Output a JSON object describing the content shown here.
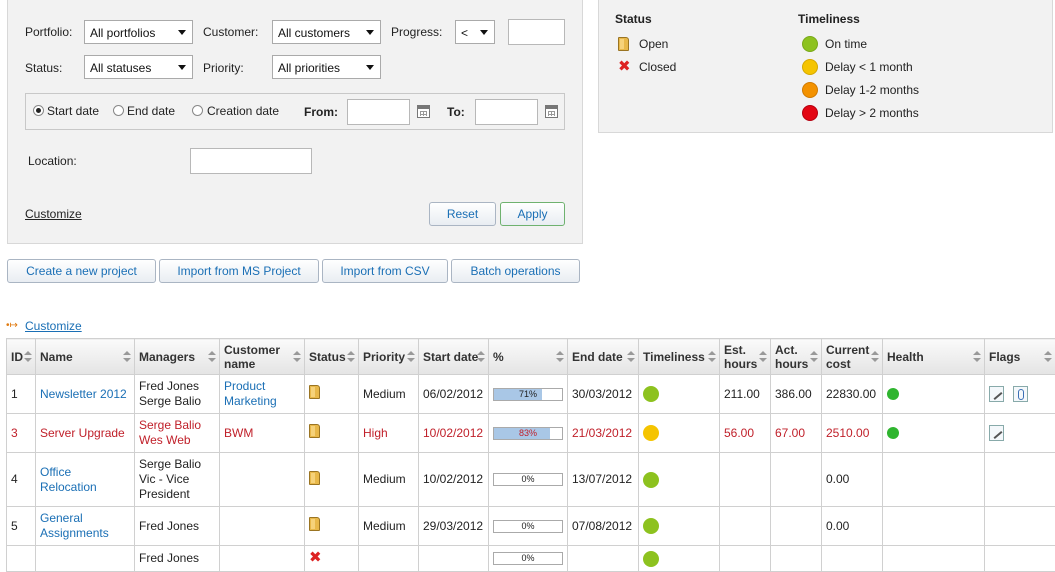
{
  "filters": {
    "portfolio_label": "Portfolio:",
    "portfolio_value": "All portfolios",
    "customer_label": "Customer:",
    "customer_value": "All customers",
    "progress_label": "Progress:",
    "progress_op": "<",
    "progress_value": "",
    "status_label": "Status:",
    "status_value": "All statuses",
    "priority_label": "Priority:",
    "priority_value": "All priorities",
    "date_options": [
      "Start date",
      "End date",
      "Creation date"
    ],
    "date_selected": "Start date",
    "from_label": "From:",
    "to_label": "To:",
    "location_label": "Location:",
    "customize_link": "Customize",
    "reset_button": "Reset",
    "apply_button": "Apply"
  },
  "legend": {
    "status_heading": "Status",
    "status_items": [
      {
        "label": "Open",
        "icon": "folder-icon"
      },
      {
        "label": "Closed",
        "icon": "closed-x-icon"
      }
    ],
    "timeliness_heading": "Timeliness",
    "timeliness_items": [
      {
        "label": "On time",
        "color": "#8dc21f"
      },
      {
        "label": "Delay < 1 month",
        "color": "#f5c400"
      },
      {
        "label": "Delay 1-2 months",
        "color": "#f39200"
      },
      {
        "label": "Delay > 2 months",
        "color": "#e30613"
      }
    ]
  },
  "actions": {
    "create": "Create a new project",
    "import_ms": "Import from MS Project",
    "import_csv": "Import from CSV",
    "batch": "Batch operations"
  },
  "table_customize": "Customize",
  "columns": {
    "id": "ID",
    "name": "Name",
    "managers": "Managers",
    "customer": "Customer name",
    "status": "Status",
    "priority": "Priority",
    "start": "Start date",
    "pct": "%",
    "end": "End date",
    "timeliness": "Timeliness",
    "est": "Est. hours",
    "act": "Act. hours",
    "cost": "Current cost",
    "health": "Health",
    "flags": "Flags"
  },
  "rows": [
    {
      "id": "1",
      "name": "Newsletter 2012",
      "managers": [
        "Fred Jones",
        "Serge Balio"
      ],
      "customer": "Product Marketing",
      "status": "open",
      "priority": "Medium",
      "start": "06/02/2012",
      "pct": 71,
      "pct_label": "71%",
      "end": "30/03/2012",
      "timeliness": "#8dc21f",
      "est": "211.00",
      "act": "386.00",
      "cost": "22830.00",
      "health": "#2fb52f",
      "flags": [
        "note-flag-icon",
        "attachment-flag-icon"
      ],
      "overdue": false
    },
    {
      "id": "3",
      "name": "Server Upgrade",
      "managers": [
        "Serge Balio",
        "Wes Web"
      ],
      "customer": "BWM",
      "status": "open",
      "priority": "High",
      "start": "10/02/2012",
      "pct": 83,
      "pct_label": "83%",
      "end": "21/03/2012",
      "timeliness": "#f5c400",
      "est": "56.00",
      "act": "67.00",
      "cost": "2510.00",
      "health": "#2fb52f",
      "flags": [
        "note-flag-icon"
      ],
      "overdue": true
    },
    {
      "id": "4",
      "name": "Office Relocation",
      "managers": [
        "Serge Balio",
        "Vic - Vice President"
      ],
      "customer": "",
      "status": "open",
      "priority": "Medium",
      "start": "10/02/2012",
      "pct": 0,
      "pct_label": "0%",
      "end": "13/07/2012",
      "timeliness": "#8dc21f",
      "est": "",
      "act": "",
      "cost": "0.00",
      "health": "",
      "flags": [],
      "overdue": false
    },
    {
      "id": "5",
      "name": "General Assignments",
      "managers": [
        "Fred Jones"
      ],
      "customer": "",
      "status": "open",
      "priority": "Medium",
      "start": "29/03/2012",
      "pct": 0,
      "pct_label": "0%",
      "end": "07/08/2012",
      "timeliness": "#8dc21f",
      "est": "",
      "act": "",
      "cost": "0.00",
      "health": "",
      "flags": [],
      "overdue": false
    },
    {
      "id": "",
      "name": "",
      "managers": [
        "Fred Jones"
      ],
      "customer": "",
      "status": "closed",
      "priority": "",
      "start": "",
      "pct": 0,
      "pct_label": "0%",
      "end": "",
      "timeliness": "#8dc21f",
      "est": "",
      "act": "",
      "cost": "",
      "health": "",
      "flags": [],
      "overdue": false
    }
  ]
}
